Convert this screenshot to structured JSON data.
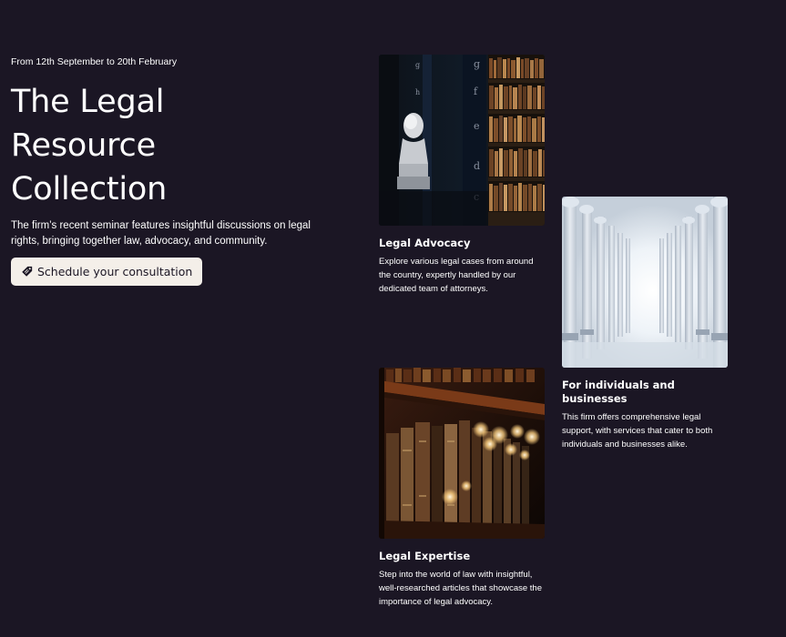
{
  "hero": {
    "eyebrow": "From 12th September to 20th February",
    "title_lines": [
      "The Legal",
      "Resource",
      "Collection"
    ],
    "intro": "The firm’s recent seminar features insightful discussions on legal rights, bringing together law, advocacy, and community.",
    "cta_label": "Schedule your consultation",
    "cta_icon": "tag-icon"
  },
  "cards": [
    {
      "image": "library-bust-image",
      "title": "Legal Advocacy",
      "text": "Explore various legal cases from around the country, expertly handled by our dedicated team of attorneys."
    },
    {
      "image": "white-columns-image",
      "title": "For individuals and businesses",
      "text": "This firm offers comprehensive legal support, with services that cater to both individuals and businesses alike."
    },
    {
      "image": "bookshelf-lights-image",
      "title": "Legal Expertise",
      "text": "Step into the world of law with insightful, well-researched articles that showcase the importance of legal advocacy."
    }
  ],
  "colors": {
    "background": "#1b1624",
    "button_bg": "#f4efe9",
    "text": "#ffffff"
  }
}
